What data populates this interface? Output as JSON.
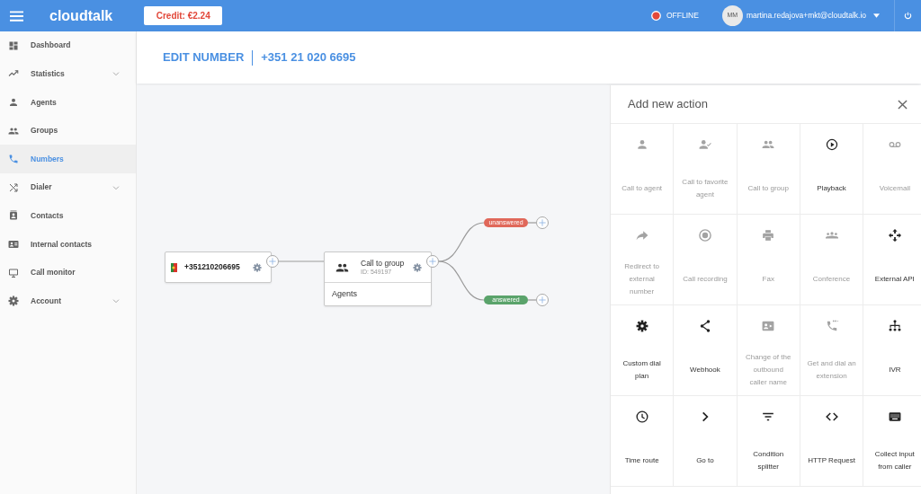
{
  "topbar": {
    "logo": "cloudtalk",
    "credit": "Credit: €2.24",
    "status": "OFFLINE",
    "user": {
      "initials": "MM",
      "email": "martina.redajova+mkt@cloudtalk.io"
    }
  },
  "sidebar": {
    "items": [
      {
        "label": "Dashboard",
        "selected": false,
        "has_submenu": false
      },
      {
        "label": "Statistics",
        "selected": false,
        "has_submenu": true
      },
      {
        "label": "Agents",
        "selected": false,
        "has_submenu": false
      },
      {
        "label": "Groups",
        "selected": false,
        "has_submenu": false
      },
      {
        "label": "Numbers",
        "selected": true,
        "has_submenu": false
      },
      {
        "label": "Dialer",
        "selected": false,
        "has_submenu": true
      },
      {
        "label": "Contacts",
        "selected": false,
        "has_submenu": false
      },
      {
        "label": "Internal contacts",
        "selected": false,
        "has_submenu": false
      },
      {
        "label": "Call monitor",
        "selected": false,
        "has_submenu": false
      },
      {
        "label": "Account",
        "selected": false,
        "has_submenu": true
      }
    ]
  },
  "header": {
    "title": "EDIT NUMBER",
    "number": "+351 21 020 6695"
  },
  "flow": {
    "nodes": [
      {
        "kind": "number",
        "label": "+351210206695"
      },
      {
        "kind": "action",
        "title": "Call to group",
        "id": "ID: 549197",
        "group": "Agents"
      }
    ],
    "branches": [
      {
        "label": "unanswered",
        "color": "#e0685a"
      },
      {
        "label": "answered",
        "color": "#5aa36b"
      }
    ]
  },
  "panel": {
    "title": "Add new action",
    "actions": [
      {
        "label": "Call to agent",
        "disabled": true
      },
      {
        "label": "Call to favorite agent",
        "disabled": true
      },
      {
        "label": "Call to group",
        "disabled": true
      },
      {
        "label": "Playback",
        "disabled": false
      },
      {
        "label": "Voicemail",
        "disabled": true
      },
      {
        "label": "Redirect to external number",
        "disabled": true
      },
      {
        "label": "Call recording",
        "disabled": true
      },
      {
        "label": "Fax",
        "disabled": true
      },
      {
        "label": "Conference",
        "disabled": true
      },
      {
        "label": "External API",
        "disabled": false
      },
      {
        "label": "Custom dial plan",
        "disabled": false
      },
      {
        "label": "Webhook",
        "disabled": false
      },
      {
        "label": "Change of the outbound caller name",
        "disabled": true
      },
      {
        "label": "Get and dial an extension",
        "disabled": true
      },
      {
        "label": "IVR",
        "disabled": false
      },
      {
        "label": "Time route",
        "disabled": false
      },
      {
        "label": "Go to",
        "disabled": false
      },
      {
        "label": "Condition splitter",
        "disabled": false
      },
      {
        "label": "HTTP Request",
        "disabled": false
      },
      {
        "label": "Collect input from caller",
        "disabled": false
      }
    ]
  }
}
